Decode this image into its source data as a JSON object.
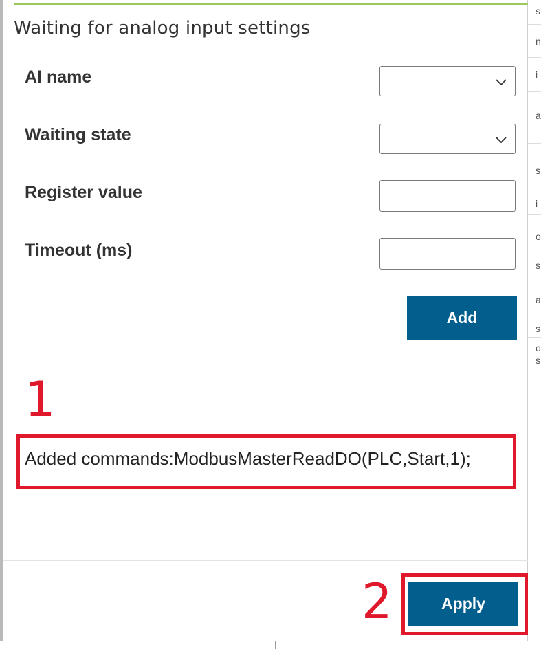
{
  "dialog": {
    "title": "Waiting for analog input settings",
    "fields": [
      {
        "label": "AI name",
        "type": "select",
        "value": ""
      },
      {
        "label": "Waiting state",
        "type": "select",
        "value": ""
      },
      {
        "label": "Register value",
        "type": "text",
        "value": ""
      },
      {
        "label": "Timeout (ms)",
        "type": "text",
        "value": ""
      }
    ],
    "add_label": "Add",
    "commands_text": "Added commands:ModbusMasterReadDO(PLC,Start,1);",
    "apply_label": "Apply"
  },
  "annotations": {
    "one": "1",
    "two": "2"
  },
  "background_glyphs": [
    "s",
    "n",
    "i",
    "a",
    "s",
    "i",
    "o",
    "s",
    "a",
    "s",
    "o",
    "s"
  ],
  "colors": {
    "accent": "#025e8c",
    "highlight": "#e0182b",
    "rule": "#9ec95a"
  },
  "icons": {
    "dropdown": "chevron-down-icon"
  }
}
